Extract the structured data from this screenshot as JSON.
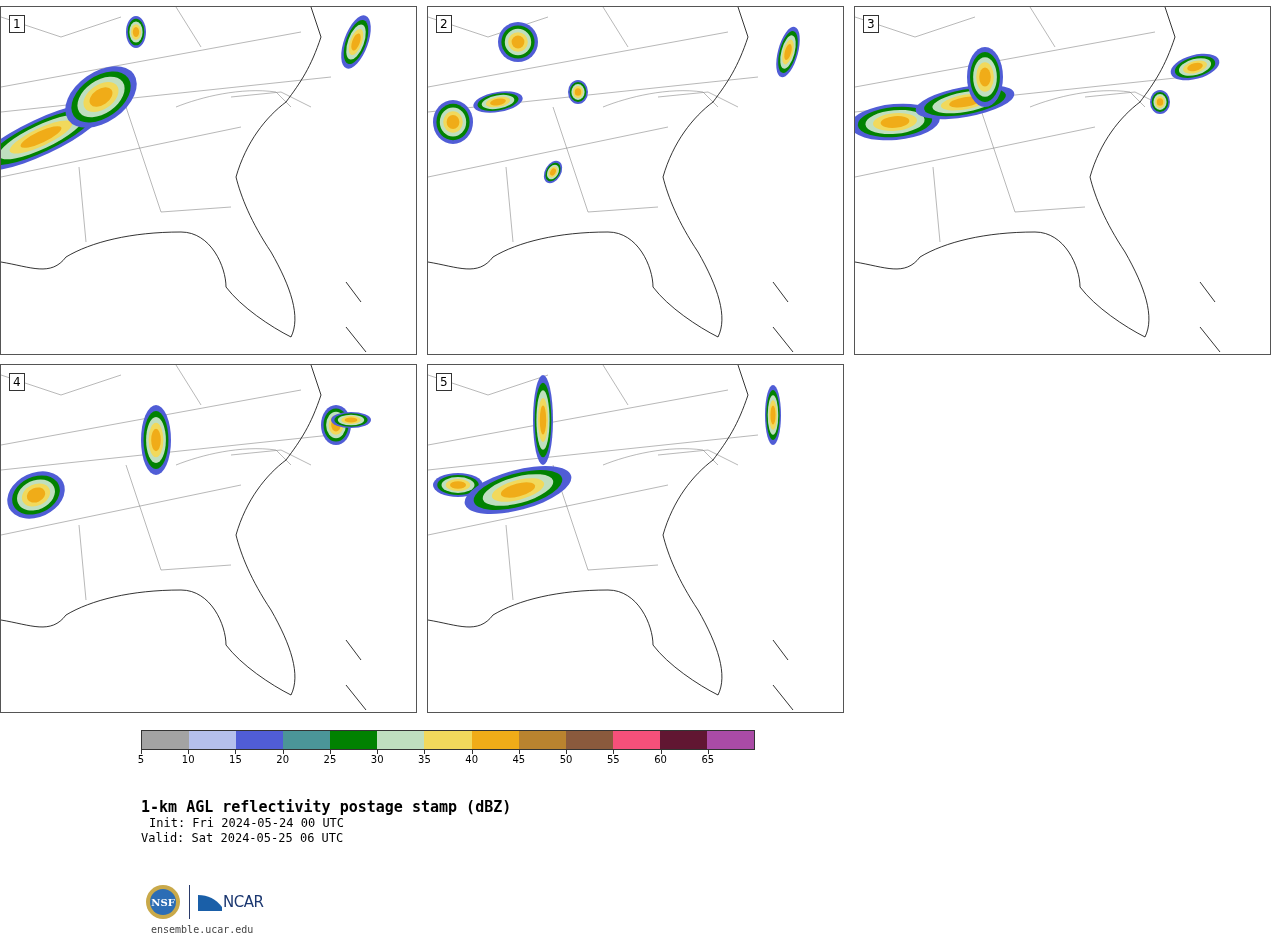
{
  "panels": [
    {
      "label": "1"
    },
    {
      "label": "2"
    },
    {
      "label": "3"
    },
    {
      "label": "4"
    },
    {
      "label": "5"
    }
  ],
  "colorbar": {
    "bins": [
      {
        "color": "#a3a3a3"
      },
      {
        "color": "#b5c0ec"
      },
      {
        "color": "#505dd6"
      },
      {
        "color": "#4b9598"
      },
      {
        "color": "#018201"
      },
      {
        "color": "#bfdfbf"
      },
      {
        "color": "#f1d95c"
      },
      {
        "color": "#f0ac18"
      },
      {
        "color": "#b9832f"
      },
      {
        "color": "#8a5a3d"
      },
      {
        "color": "#f5507a"
      },
      {
        "color": "#611632"
      },
      {
        "color": "#aa4ba6"
      }
    ],
    "ticks": [
      "5",
      "10",
      "15",
      "20",
      "25",
      "30",
      "35",
      "40",
      "45",
      "50",
      "55",
      "60",
      "65"
    ]
  },
  "title": "1-km AGL reflectivity postage stamp (dBZ)",
  "init": "Init: Fri 2024-05-24 00 UTC",
  "valid": "Valid: Sat 2024-05-25 06 UTC",
  "logos": {
    "nsf": "NSF",
    "ncar": "NCAR"
  },
  "site": "ensemble.ucar.edu"
}
